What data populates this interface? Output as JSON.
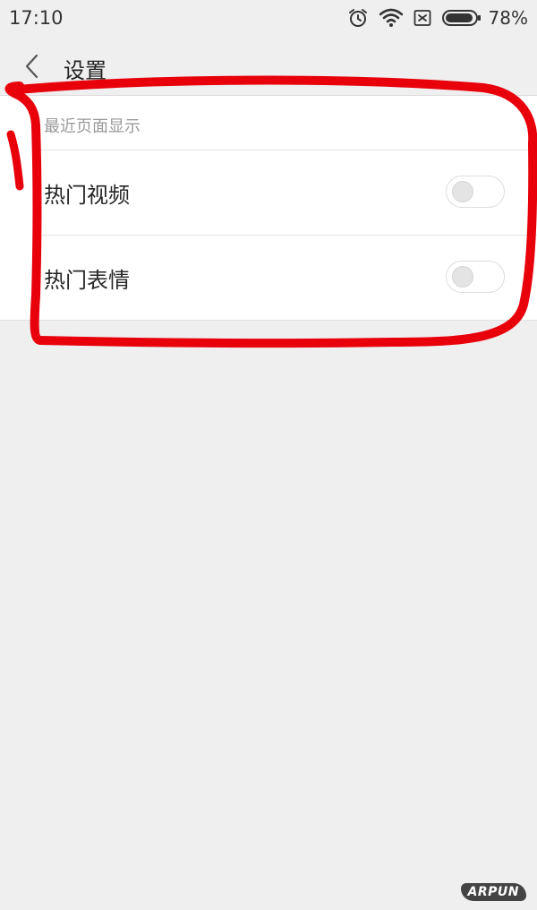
{
  "status_bar": {
    "time": "17:10",
    "battery_percent": "78%",
    "icons": [
      "alarm-icon",
      "wifi-icon",
      "no-sim-icon",
      "battery-icon"
    ]
  },
  "header": {
    "back_icon": "chevron-left-icon",
    "title": "设置"
  },
  "settings": {
    "section_title": "最近页面显示",
    "items": [
      {
        "label": "热门视频",
        "enabled": false
      },
      {
        "label": "热门表情",
        "enabled": false
      }
    ]
  },
  "annotation": {
    "color": "#e8000b"
  },
  "watermark": {
    "text": "ARPUN"
  },
  "colors": {
    "background": "#efefef",
    "card": "#ffffff",
    "toggle_off_knob": "#e4e4e4"
  }
}
